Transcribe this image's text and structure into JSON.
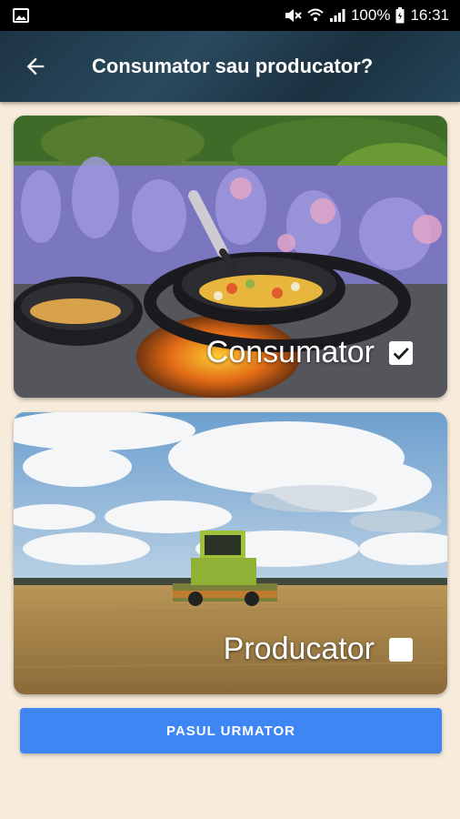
{
  "status_bar": {
    "battery_percent": "100%",
    "time": "16:31",
    "icons": [
      "image-icon",
      "mute-icon",
      "wifi-icon",
      "signal-icon",
      "battery-icon"
    ]
  },
  "app_bar": {
    "title": "Consumator sau producator?",
    "back_icon": "arrow-back-icon",
    "color": "#1f3a4c"
  },
  "options": [
    {
      "label": "Consumator",
      "checked": true,
      "image": "cooking-pans-lavender"
    },
    {
      "label": "Producator",
      "checked": false,
      "image": "combine-harvester-field"
    }
  ],
  "actions": {
    "next_label": "PASUL URMATOR",
    "accent": "#3f86f5"
  },
  "background": "#f7ebdb"
}
